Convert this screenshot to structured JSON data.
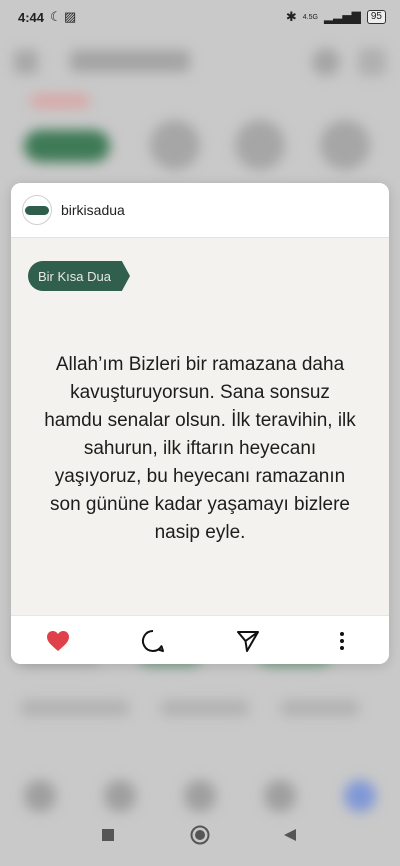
{
  "status_bar": {
    "time": "4:44",
    "net_label": "4.5G",
    "battery": "95"
  },
  "post": {
    "username": "birkisadua",
    "tag": "Bir Kısa Dua",
    "text": "Allah’ım Bizleri bir ramazana daha kavuşturuyorsun. Sana sonsuz hamdu senalar olsun. İlk teravihin, ilk sahurun, ilk iftarın heyecanı yaşıyoruz, bu heyecanı ramazanın son gününe kadar yaşamayı bizlere nasip eyle."
  },
  "actions": {
    "like_icon": "heart-icon",
    "comment_icon": "comment-icon",
    "share_icon": "send-icon",
    "more_icon": "more-vertical-icon"
  },
  "colors": {
    "accent_green": "#315f4d",
    "like_red": "#e0404a"
  }
}
